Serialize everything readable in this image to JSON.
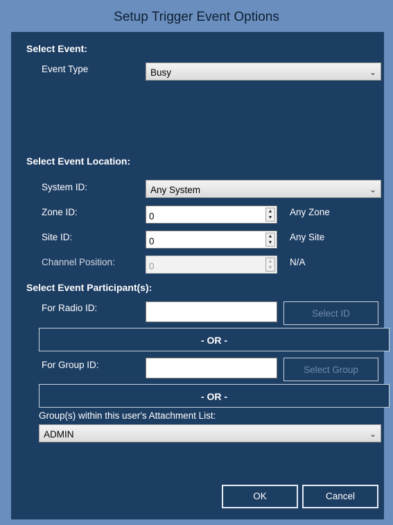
{
  "window": {
    "title": "Setup Trigger Event Options"
  },
  "select_event": {
    "heading": "Select Event:",
    "event_type_label": "Event Type",
    "event_type_value": "Busy"
  },
  "location": {
    "heading": "Select Event Location:",
    "system_label": "System ID:",
    "system_value": "Any System",
    "zone_label": "Zone ID:",
    "zone_value": "0",
    "zone_note": "Any Zone",
    "site_label": "Site ID:",
    "site_value": "0",
    "site_note": "Any Site",
    "channel_label": "Channel Position:",
    "channel_value": "0",
    "channel_note": "N/A"
  },
  "participants": {
    "heading": "Select Event Participant(s):",
    "radio_label": "For Radio ID:",
    "radio_value": "",
    "select_id_label": "Select ID",
    "or_1": "- OR -",
    "group_label": "For Group ID:",
    "group_value": "",
    "select_group_label": "Select Group",
    "or_2": "- OR -",
    "attachment_label": "Group(s) within this user's Attachment List:",
    "attachment_value": "ADMIN"
  },
  "footer": {
    "ok_label": "OK",
    "cancel_label": "Cancel"
  },
  "colors": {
    "title_bar": "#6a8fbe",
    "client_bg": "#1d3e63",
    "text": "#ffffff"
  },
  "icons": {
    "dropdown": "chevron-down-icon",
    "spin": "spin-updown-icon"
  }
}
